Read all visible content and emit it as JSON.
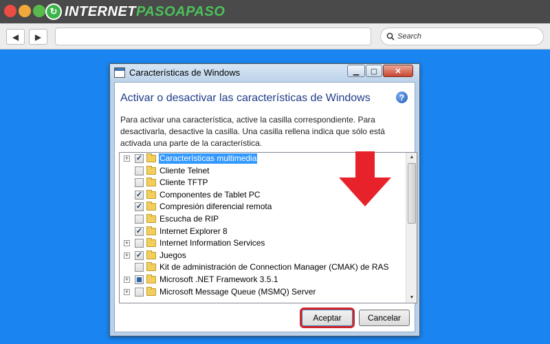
{
  "browser": {
    "logo_text_1": "INTERNET",
    "logo_text_2": "PASOAPASO",
    "search_placeholder": "Search",
    "back_icon": "back-arrow-icon",
    "forward_icon": "forward-arrow-icon"
  },
  "dialog": {
    "title": "Características de Windows",
    "heading": "Activar o desactivar las características de Windows",
    "description": "Para activar una característica, active la casilla correspondiente. Para desactivarla, desactive la casilla. Una casilla rellena indica que sólo está activada una parte de la característica.",
    "features": [
      {
        "label": "Características multimedia",
        "state": "checked",
        "expandable": true,
        "selected": true
      },
      {
        "label": "Cliente Telnet",
        "state": "unchecked",
        "expandable": false,
        "selected": false
      },
      {
        "label": "Cliente TFTP",
        "state": "unchecked",
        "expandable": false,
        "selected": false
      },
      {
        "label": "Componentes de Tablet PC",
        "state": "checked",
        "expandable": false,
        "selected": false
      },
      {
        "label": "Compresión diferencial remota",
        "state": "checked",
        "expandable": false,
        "selected": false
      },
      {
        "label": "Escucha de RIP",
        "state": "unchecked",
        "expandable": false,
        "selected": false
      },
      {
        "label": "Internet Explorer 8",
        "state": "checked",
        "expandable": false,
        "selected": false
      },
      {
        "label": "Internet Information Services",
        "state": "unchecked",
        "expandable": true,
        "selected": false
      },
      {
        "label": "Juegos",
        "state": "checked",
        "expandable": true,
        "selected": false
      },
      {
        "label": "Kit de administración de Connection Manager (CMAK) de RAS",
        "state": "unchecked",
        "expandable": false,
        "selected": false
      },
      {
        "label": "Microsoft .NET Framework 3.5.1",
        "state": "partial",
        "expandable": true,
        "selected": false
      },
      {
        "label": "Microsoft Message Queue (MSMQ) Server",
        "state": "unchecked",
        "expandable": true,
        "selected": false
      }
    ],
    "ok_label": "Aceptar",
    "cancel_label": "Cancelar"
  },
  "colors": {
    "background": "#1a85f0",
    "annotation_red": "#e8222b",
    "heading_blue": "#1e3b87",
    "selection": "#3399ff"
  }
}
